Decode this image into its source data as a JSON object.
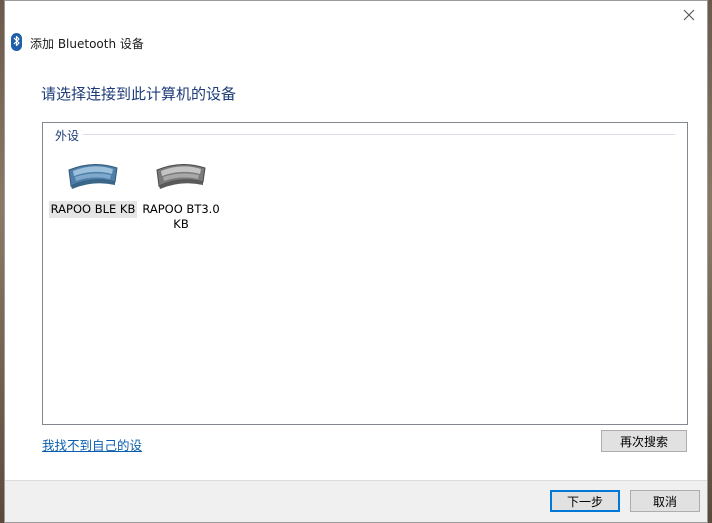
{
  "window": {
    "title": "添加 Bluetooth 设备",
    "close_glyph": "✕"
  },
  "heading": "请选择连接到此计算机的设备",
  "group": {
    "label": "外设",
    "devices": [
      {
        "name": "RAPOO BLE KB",
        "icon": "keyboard-icon",
        "color": "#5b88b0",
        "selected": true
      },
      {
        "name": "RAPOO BT3.0 KB",
        "icon": "keyboard-icon",
        "color": "#8a8a8a",
        "selected": false
      }
    ]
  },
  "link_text": "我找不到自己的设",
  "buttons": {
    "research": "再次搜索",
    "next": "下一步",
    "cancel": "取消"
  },
  "colors": {
    "heading": "#1e3c78",
    "link": "#0b5fb0",
    "primary_border": "#0078d7"
  }
}
